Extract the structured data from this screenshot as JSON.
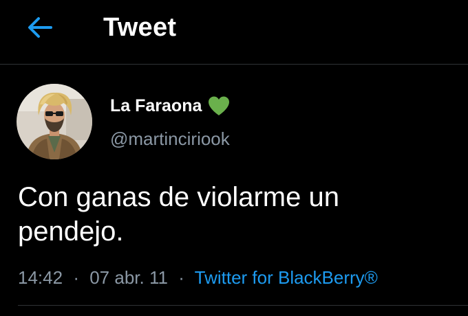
{
  "header": {
    "title": "Tweet",
    "back_icon": "arrow-left-icon",
    "accent_color": "#1d9bf0"
  },
  "tweet": {
    "author": {
      "display_name": "La Faraona",
      "emoji_icon": "green-heart-icon",
      "emoji_color": "#6ab04c",
      "handle": "@martinciriook"
    },
    "text": "Con ganas de violarme un pendejo.",
    "time": "14:42",
    "date": "07 abr. 11",
    "source": "Twitter for BlackBerry®",
    "separator": "·"
  }
}
